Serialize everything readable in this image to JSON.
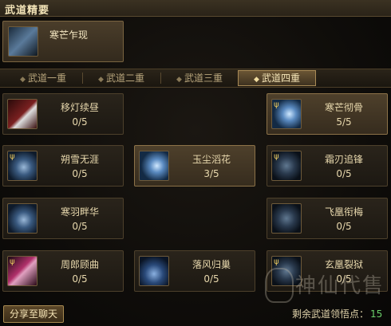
{
  "title": "武道精要",
  "featured": {
    "name": "寒芒乍现",
    "icon": "blade-strike-icon"
  },
  "tabs": [
    {
      "label": "武道一重",
      "active": false
    },
    {
      "label": "武道二重",
      "active": false
    },
    {
      "label": "武道三重",
      "active": false
    },
    {
      "label": "武道四重",
      "active": true
    }
  ],
  "skills": [
    {
      "name": "移灯续昼",
      "progress": "0/5",
      "icon": "lantern-swipe-icon",
      "lit": false
    },
    {
      "name": "寒芒彻骨",
      "progress": "5/5",
      "icon": "ice-burst-icon",
      "lit": true
    },
    {
      "name": "朔雪无涯",
      "progress": "0/5",
      "icon": "snowflake-icon",
      "lit": false
    },
    {
      "name": "玉尘滔花",
      "progress": "3/5",
      "icon": "snow-blossom-icon",
      "lit": true
    },
    {
      "name": "霜刃追锋",
      "progress": "0/5",
      "icon": "frost-blade-icon",
      "lit": false
    },
    {
      "name": "寒羽畔华",
      "progress": "0/5",
      "icon": "frost-feather-icon",
      "lit": false
    },
    {
      "name": "飞凰衔梅",
      "progress": "0/5",
      "icon": "phoenix-plum-icon",
      "lit": false
    },
    {
      "name": "周郎顾曲",
      "progress": "0/5",
      "icon": "song-icon",
      "lit": false
    },
    {
      "name": "落风归巢",
      "progress": "0/5",
      "icon": "wind-return-icon",
      "lit": false
    },
    {
      "name": "玄凰裂狱",
      "progress": "0/5",
      "icon": "dark-phoenix-icon",
      "lit": false
    }
  ],
  "share_label": "分享至聊天",
  "remaining": {
    "label": "剩余武道领悟点：",
    "value": "15"
  },
  "watermark": "神仙代售"
}
